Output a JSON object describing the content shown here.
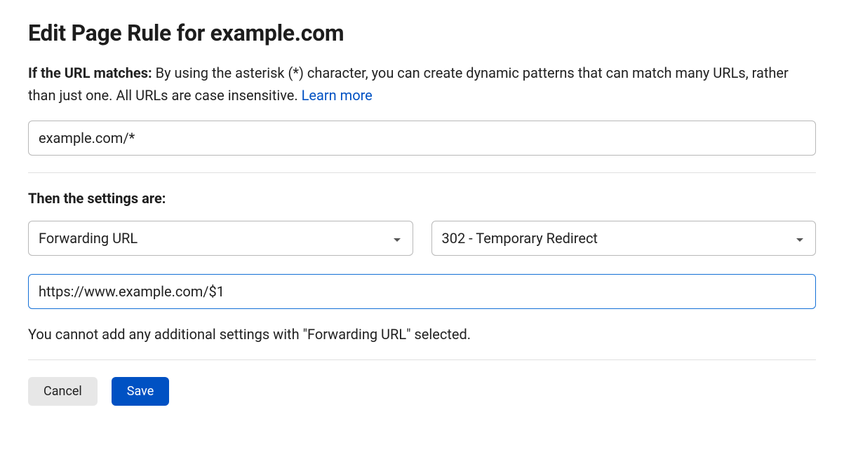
{
  "header": {
    "title": "Edit Page Rule for example.com"
  },
  "urlMatch": {
    "label": "If the URL matches:",
    "description": "By using the asterisk (*) character, you can create dynamic patterns that can match many URLs, rather than just one. All URLs are case insensitive.",
    "learnMore": "Learn more",
    "value": "example.com/*"
  },
  "settings": {
    "label": "Then the settings are:",
    "settingType": "Forwarding URL",
    "redirectType": "302 - Temporary Redirect",
    "destinationUrl": "https://www.example.com/$1",
    "infoText": "You cannot add any additional settings with \"Forwarding URL\" selected."
  },
  "buttons": {
    "cancel": "Cancel",
    "save": "Save"
  }
}
